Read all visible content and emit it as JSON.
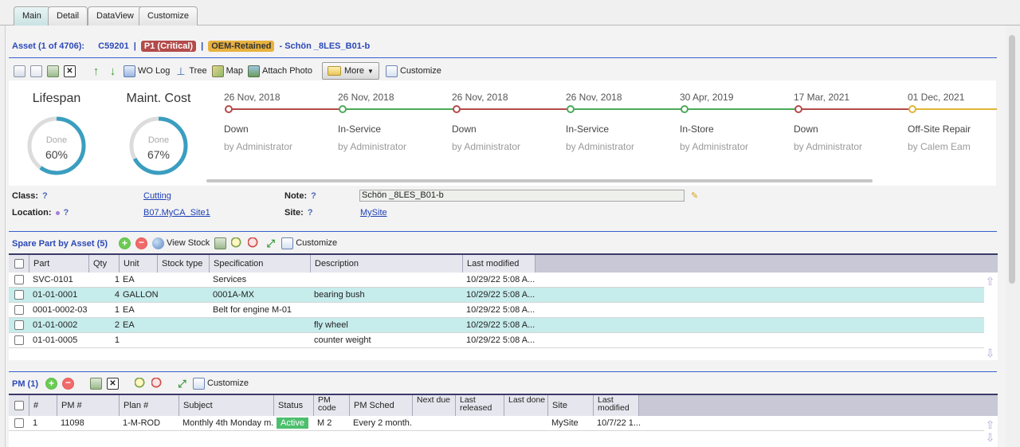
{
  "tabs": [
    "Main",
    "Detail",
    "DataView",
    "Customize"
  ],
  "header": {
    "asset_count": "Asset (1 of 4706):",
    "asset_id": "C59201",
    "priority": "P1 (Critical)",
    "retained": "OEM-Retained",
    "asset_name": "- Schön _8LES_B01-b",
    "sep": "|"
  },
  "toolbar": {
    "wo_log": "WO Log",
    "tree": "Tree",
    "map": "Map",
    "attach_photo": "Attach Photo",
    "more": "More",
    "customize": "Customize"
  },
  "gauges": [
    {
      "title": "Lifespan",
      "label": "Done",
      "value": "60%",
      "fraction": 0.6
    },
    {
      "title": "Maint. Cost",
      "label": "Done",
      "value": "67%",
      "fraction": 0.67
    }
  ],
  "timeline": [
    {
      "date": "26 Nov, 2018",
      "status": "Down",
      "by": "by Administrator",
      "color": "#b44a4a"
    },
    {
      "date": "26 Nov, 2018",
      "status": "In-Service",
      "by": "by Administrator",
      "color": "#4caa5a"
    },
    {
      "date": "26 Nov, 2018",
      "status": "Down",
      "by": "by Administrator",
      "color": "#b44a4a"
    },
    {
      "date": "26 Nov, 2018",
      "status": "In-Service",
      "by": "by Administrator",
      "color": "#4caa5a"
    },
    {
      "date": "30 Apr, 2019",
      "status": "In-Store",
      "by": "by Administrator",
      "color": "#4caa5a"
    },
    {
      "date": "17 Mar, 2021",
      "status": "Down",
      "by": "by Administrator",
      "color": "#b44a4a"
    },
    {
      "date": "01 Dec, 2021",
      "status": "Off-Site Repair",
      "by": "by Calem Eam",
      "color": "#e0b43a"
    }
  ],
  "fields": {
    "class_label": "Class:",
    "class_value": "Cutting",
    "location_label": "Location:",
    "location_value": "B07.MyCA_Site1",
    "note_label": "Note:",
    "note_value": "Schön  _8LES_B01-b",
    "site_label": "Site:",
    "site_value": "MySite",
    "help": "?"
  },
  "spare": {
    "title": "Spare Part by Asset (5)",
    "view_stock": "View Stock",
    "customize": "Customize",
    "headers": [
      "Part",
      "Qty",
      "Unit",
      "Stock type",
      "Specification",
      "Description",
      "Last modified"
    ],
    "rows": [
      {
        "part": "SVC-0101",
        "qty": "1",
        "unit": "EA",
        "stock": "",
        "spec": "Services",
        "desc": "",
        "modified": "10/29/22 5:08 A..."
      },
      {
        "part": "01-01-0001",
        "qty": "4",
        "unit": "GALLON",
        "stock": "",
        "spec": "0001A-MX",
        "desc": "bearing bush",
        "modified": "10/29/22 5:08 A..."
      },
      {
        "part": "0001-0002-03",
        "qty": "1",
        "unit": "EA",
        "stock": "",
        "spec": "Belt for engine M-01",
        "desc": "",
        "modified": "10/29/22 5:08 A..."
      },
      {
        "part": "01-01-0002",
        "qty": "2",
        "unit": "EA",
        "stock": "",
        "spec": "",
        "desc": "fly wheel",
        "modified": "10/29/22 5:08 A..."
      },
      {
        "part": "01-01-0005",
        "qty": "1",
        "unit": "",
        "stock": "",
        "spec": "",
        "desc": "counter weight",
        "modified": "10/29/22 5:08 A..."
      }
    ]
  },
  "pm": {
    "title": "PM (1)",
    "customize": "Customize",
    "headers": [
      "#",
      "PM #",
      "Plan #",
      "Subject",
      "Status",
      "PM code",
      "PM Sched",
      "Next due",
      "Last released",
      "Last done",
      "Site",
      "Last modified"
    ],
    "rows": [
      {
        "num": "1",
        "pm": "11098",
        "plan": "1-M-ROD",
        "subject": "Monthly 4th Monday m...",
        "status": "Active",
        "code": "M 2",
        "sched": "Every 2 month...",
        "next": "",
        "released": "",
        "done": "",
        "site": "MySite",
        "modified": "10/7/22 1..."
      }
    ]
  }
}
